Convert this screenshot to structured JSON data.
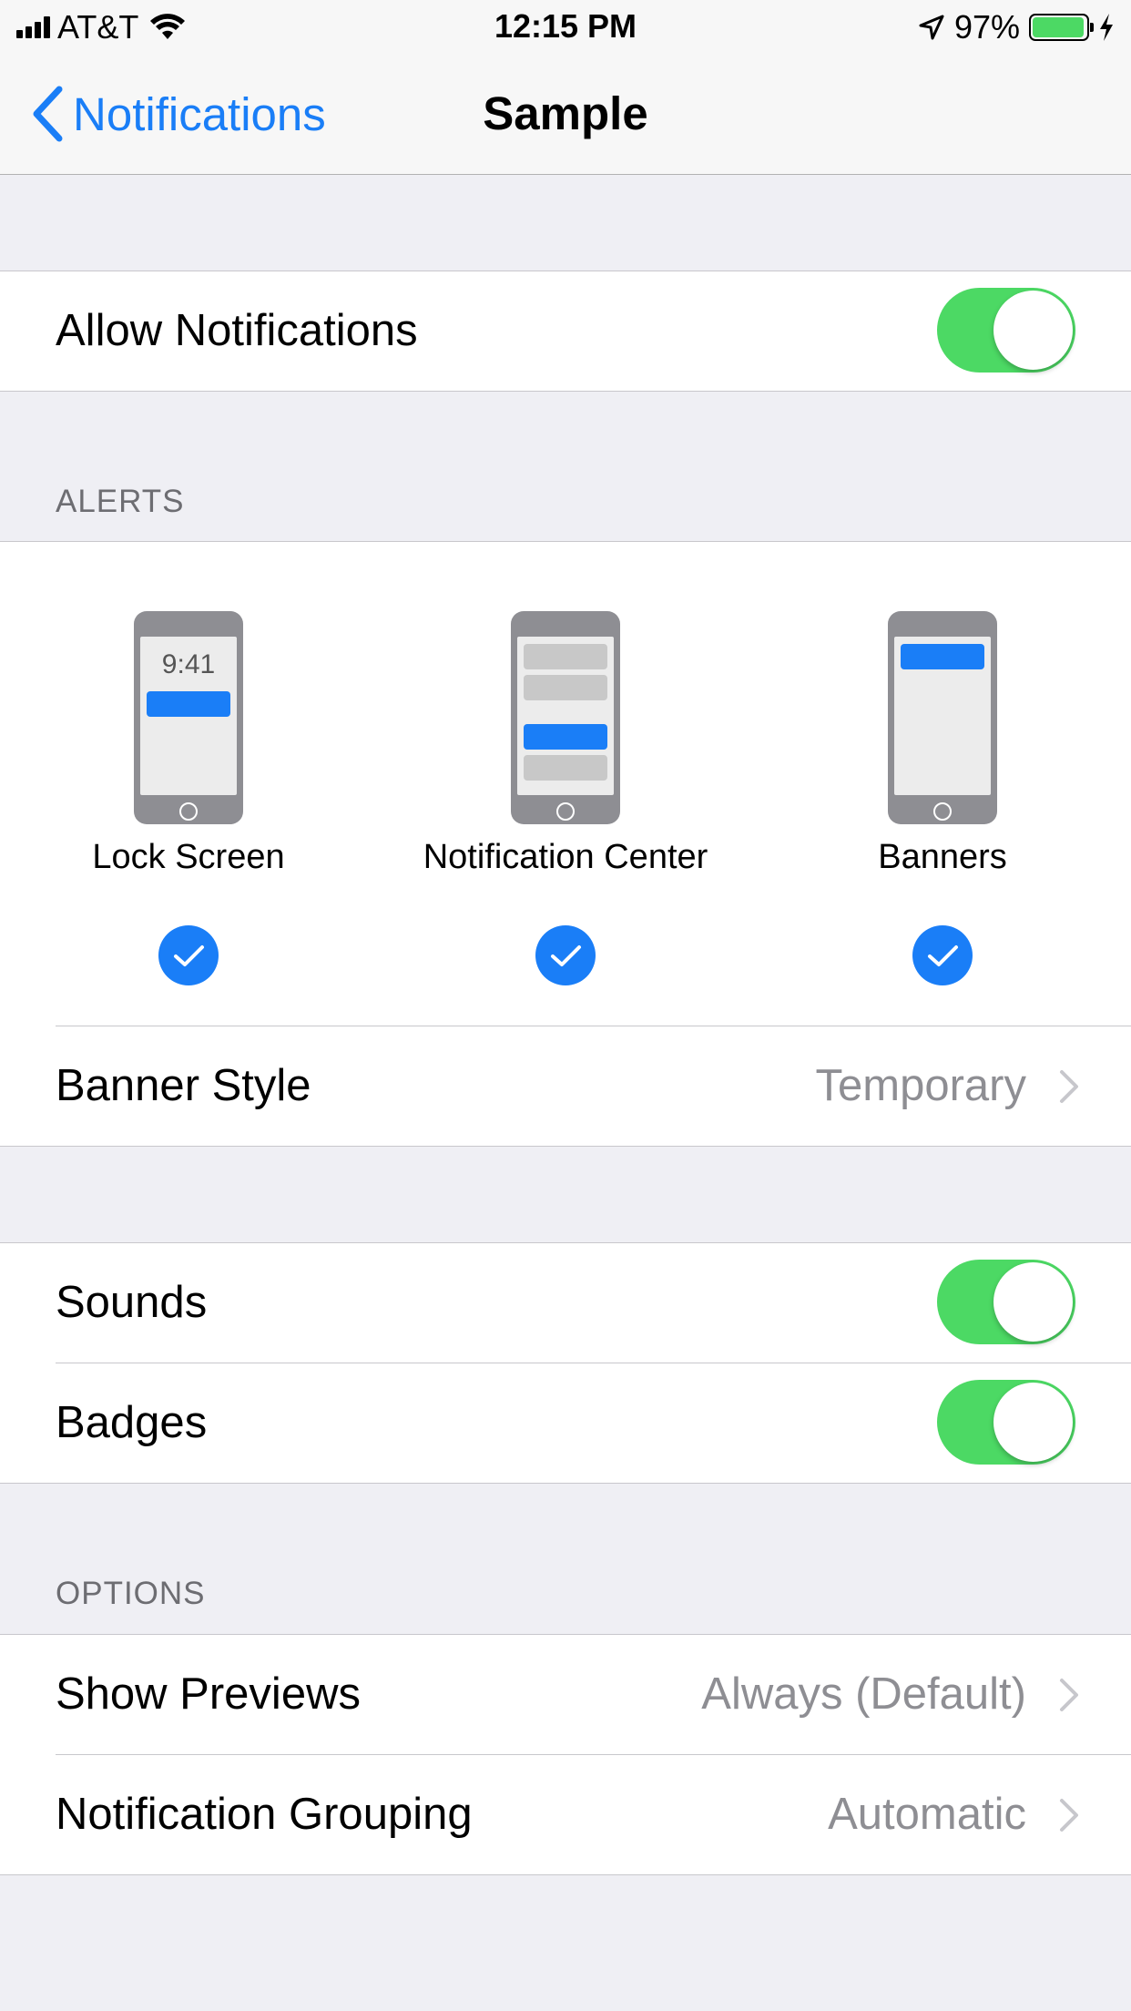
{
  "status_bar": {
    "carrier": "AT&T",
    "time": "12:15 PM",
    "battery_percent": "97%",
    "icons": [
      "signal-icon",
      "wifi-icon",
      "location-arrow-icon",
      "battery-icon",
      "charging-bolt-icon"
    ]
  },
  "nav": {
    "back_label": "Notifications",
    "title": "Sample"
  },
  "allow": {
    "label": "Allow Notifications",
    "enabled": true
  },
  "alerts": {
    "header": "ALERTS",
    "options": [
      {
        "label": "Lock Screen",
        "preview_time": "9:41",
        "checked": true
      },
      {
        "label": "Notification Center",
        "checked": true
      },
      {
        "label": "Banners",
        "checked": true
      }
    ],
    "banner_style": {
      "label": "Banner Style",
      "value": "Temporary"
    }
  },
  "sounds": {
    "label": "Sounds",
    "enabled": true
  },
  "badges": {
    "label": "Badges",
    "enabled": true
  },
  "options": {
    "header": "OPTIONS",
    "show_previews": {
      "label": "Show Previews",
      "value": "Always (Default)"
    },
    "grouping": {
      "label": "Notification Grouping",
      "value": "Automatic"
    }
  },
  "colors": {
    "accent": "#1a7ef7",
    "toggle_on": "#4cd964",
    "background": "#efeff4",
    "secondary_text": "#8e8e93"
  }
}
